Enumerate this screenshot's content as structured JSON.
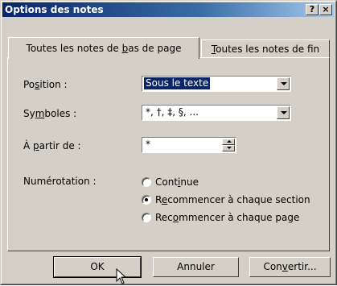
{
  "window": {
    "title": "Options des notes",
    "help_label": "?",
    "close_label": "×"
  },
  "tabs": [
    {
      "pre": "Toutes les notes de ",
      "ul": "b",
      "post": "as de page"
    },
    {
      "pre": "",
      "ul": "T",
      "post": "outes les notes de fin"
    }
  ],
  "fields": {
    "position": {
      "pre": "Po",
      "ul": "s",
      "post": "ition :",
      "value": "Sous le texte"
    },
    "symboles": {
      "pre": "Sy",
      "ul": "m",
      "post": "boles :",
      "value": "*, †, ‡, §, ..."
    },
    "partir": {
      "pre": "À ",
      "ul": "p",
      "post": "artir de :",
      "value": "*"
    },
    "numerotation": {
      "label": "Numérotation :"
    }
  },
  "radios": [
    {
      "pre": "Cont",
      "ul": "i",
      "post": "nue"
    },
    {
      "pre": "R",
      "ul": "e",
      "post": "commencer à chaque section"
    },
    {
      "pre": "Rec",
      "ul": "o",
      "post": "mmencer à chaque page"
    }
  ],
  "buttons": {
    "ok": "OK",
    "annuler": "Annuler",
    "convertir": {
      "pre": "Con",
      "ul": "v",
      "post": "ertir..."
    }
  }
}
